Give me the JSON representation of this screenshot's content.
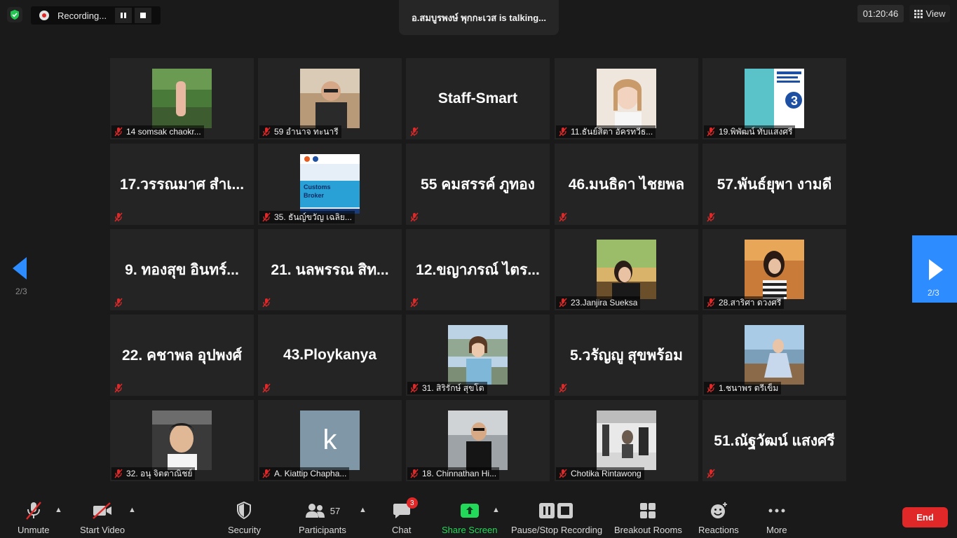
{
  "top": {
    "recording_label": "Recording...",
    "talking": "อ.สมบูรพงษ์  พุกกะเวส is  talking...",
    "timer": "01:20:46",
    "view_label": "View"
  },
  "participants": [
    {
      "name": "14 somsak chaokr...",
      "video": "photo-greenery"
    },
    {
      "name": "59 อำนาจ ทะนารี",
      "video": "photo-man-glasses"
    },
    {
      "name": "Staff-Smart",
      "video": ""
    },
    {
      "name": "11.ธันย์สิตา อัครทวีธ...",
      "video": "photo-woman-bright"
    },
    {
      "name": "19.พิพัฒน์ ทับแสงศรี",
      "video": "photo-poster-3"
    },
    {
      "name": "17.วรรณมาศ สำเ...",
      "video": ""
    },
    {
      "name": "35. ธันญ์ขวัญ เฉลิย...",
      "video": "photo-customs-broker",
      "poster_text": "Customs Broker"
    },
    {
      "name": "55 คมสรรค์ ภูทอง",
      "video": ""
    },
    {
      "name": "46.มนธิดา  ไชยพล",
      "video": ""
    },
    {
      "name": "57.พันธ์ยุพา งามดี",
      "video": ""
    },
    {
      "name": "9. ทองสุข อินทร์...",
      "video": ""
    },
    {
      "name": "21. นลพรรณ สิท...",
      "video": ""
    },
    {
      "name": "12.ขญาภรณ์ ไตร...",
      "video": ""
    },
    {
      "name": "23.Janjira Sueksa",
      "video": "photo-woman-sunset"
    },
    {
      "name": "28.สาริศา ดวงศรี",
      "video": "photo-woman-stripes"
    },
    {
      "name": "22. คชาพล อุปพงศ์",
      "video": ""
    },
    {
      "name": "43.Ploykanya",
      "video": ""
    },
    {
      "name": "31. สิริรักษ์ สุขโต",
      "video": "photo-woman-outdoor"
    },
    {
      "name": "5.วรัญญู สุขพร้อม",
      "video": ""
    },
    {
      "name": "1.ชนาพร  ตรีเข็ม",
      "video": "photo-woman-pier"
    },
    {
      "name": "32. อนุ จิตตาณิชย์",
      "video": "photo-man-car"
    },
    {
      "name": "A. Kiattip Chapha...",
      "video": "avatar-k",
      "avatar_letter": "k"
    },
    {
      "name": "18. Chinnathan Hi...",
      "video": "photo-man-black"
    },
    {
      "name": "Chotika Rintawong",
      "video": "photo-room-bw"
    },
    {
      "name": "51.ณัฐวัฒน์ แสงศรี",
      "video": ""
    }
  ],
  "pager": {
    "left": "2/3",
    "right": "2/3"
  },
  "toolbar": {
    "unmute": "Unmute",
    "start_video": "Start Video",
    "security": "Security",
    "participants": "Participants",
    "participants_count": "57",
    "chat": "Chat",
    "chat_badge": "3",
    "share_screen": "Share Screen",
    "recording": "Pause/Stop Recording",
    "breakout": "Breakout Rooms",
    "reactions": "Reactions",
    "more": "More",
    "end": "End"
  },
  "colors": {
    "accent": "#2d8cff",
    "share": "#23d959",
    "danger": "#e02828",
    "tile": "#242424",
    "background": "#1a1a1a"
  }
}
